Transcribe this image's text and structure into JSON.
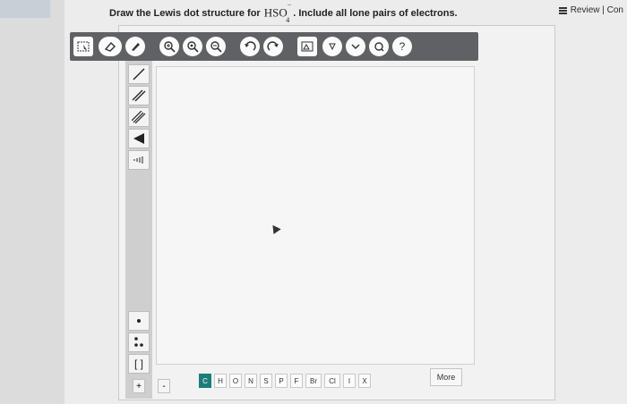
{
  "review": {
    "label": "Review | Con"
  },
  "question": {
    "prefix": "Draw the Lewis dot structure for",
    "formula_main": "HSO",
    "formula_sup": "−",
    "formula_sub": "4",
    "suffix": ". Include all lone pairs of electrons."
  },
  "toolbar": {
    "icons": [
      "select-icon",
      "eraser-icon",
      "pencil-icon",
      "zoom-fit-icon",
      "zoom-in-icon",
      "zoom-out-icon",
      "undo-icon",
      "redo-icon",
      "template-icon",
      "info-icon",
      "dropdown-icon",
      "clean-icon",
      "help-icon"
    ],
    "help_glyph": "?"
  },
  "left_tools": {
    "bracket_label": "[ ]"
  },
  "charges": {
    "plus": "+",
    "minus": "-"
  },
  "atoms": [
    "C",
    "H",
    "O",
    "N",
    "S",
    "P",
    "F",
    "Br",
    "Cl",
    "I",
    "X"
  ],
  "more": {
    "label": "More"
  },
  "colors": {
    "toolbar": "#5f6164",
    "active_atom": "#1c7d7a"
  }
}
